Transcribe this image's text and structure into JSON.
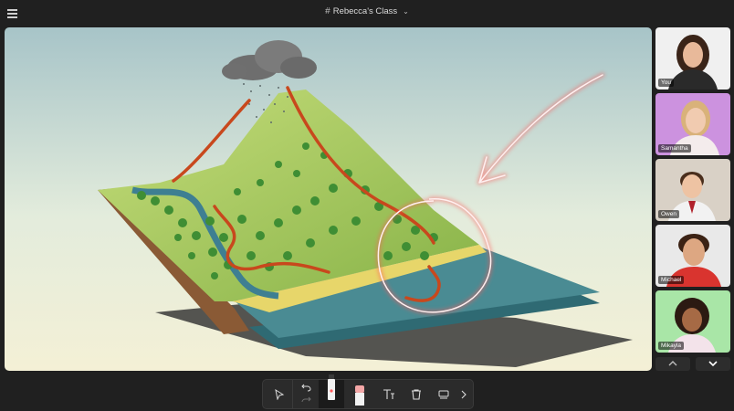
{
  "header": {
    "title": "Rebecca's Class",
    "hash_icon": "#"
  },
  "participants": [
    {
      "name": "You",
      "bg": "#f0f0f0"
    },
    {
      "name": "Samantha",
      "bg": "#cc92df"
    },
    {
      "name": "Owen",
      "bg": "#d9d1c6"
    },
    {
      "name": "Michael",
      "bg": "#e9e9e9"
    },
    {
      "name": "Mikayla",
      "bg": "#a9e6a7"
    }
  ],
  "toolbar": {
    "tools": [
      "select",
      "undo",
      "redo",
      "pen",
      "eraser",
      "text",
      "delete",
      "screen",
      "more"
    ]
  },
  "colors": {
    "accent_ink": "#ff5a5a",
    "background": "#202020",
    "panel": "#2b2b2b"
  }
}
